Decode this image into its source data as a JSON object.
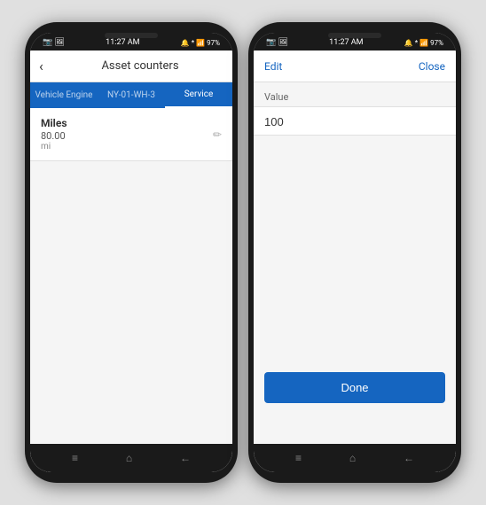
{
  "phone1": {
    "statusBar": {
      "left": "📷 🖼",
      "time": "11:27 AM",
      "icons": "🔔 * 📶 97%"
    },
    "header": {
      "back": "‹",
      "title": "Asset counters"
    },
    "tabs": [
      {
        "label": "Vehicle Engine",
        "active": false
      },
      {
        "label": "NY-01-WH-3",
        "active": false
      },
      {
        "label": "Service",
        "active": true
      }
    ],
    "card": {
      "title": "Miles",
      "value": "80.00",
      "unit": "mi",
      "editIcon": "✏"
    },
    "navBar": {
      "menu": "≡",
      "home": "⌂",
      "back": "←"
    }
  },
  "phone2": {
    "statusBar": {
      "left": "📷 🖼",
      "time": "11:27 AM",
      "icons": "🔔 * 📶 97%"
    },
    "header": {
      "editLabel": "Edit",
      "closeLabel": "Close"
    },
    "valueLabel": "Value",
    "valueInput": "100",
    "doneButton": "Done",
    "navBar": {
      "menu": "≡",
      "home": "⌂",
      "back": "←"
    }
  }
}
